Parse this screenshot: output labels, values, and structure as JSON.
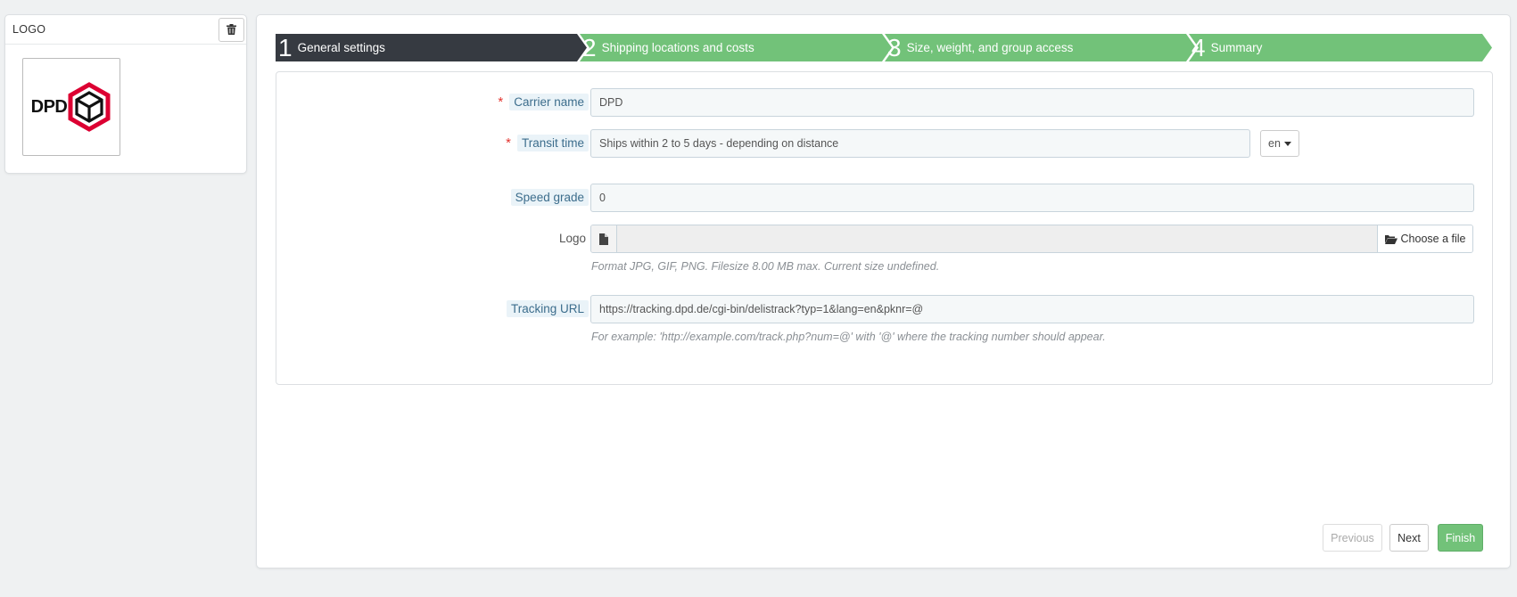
{
  "logo_panel": {
    "title": "LOGO",
    "logo_text": "DPD"
  },
  "steps": [
    {
      "number": "1",
      "label": "General settings"
    },
    {
      "number": "2",
      "label": "Shipping locations and costs"
    },
    {
      "number": "3",
      "label": "Size, weight, and group access"
    },
    {
      "number": "4",
      "label": "Summary"
    }
  ],
  "form": {
    "carrier_name": {
      "label": "Carrier name",
      "required_mark": "*",
      "value": "DPD"
    },
    "transit_time": {
      "label": "Transit time",
      "required_mark": "*",
      "value": "Ships within 2 to 5 days - depending on distance",
      "lang": "en"
    },
    "speed_grade": {
      "label": "Speed grade",
      "value": "0"
    },
    "logo": {
      "label": "Logo",
      "button": "Choose a file",
      "help": "Format JPG, GIF, PNG. Filesize 8.00 MB max. Current size undefined."
    },
    "tracking_url": {
      "label": "Tracking URL",
      "value": "https://tracking.dpd.de/cgi-bin/delistrack?typ=1&lang=en&pknr=@",
      "help": "For example: 'http://example.com/track.php?num=@' with '@' where the tracking number should appear."
    }
  },
  "footer": {
    "previous": "Previous",
    "next": "Next",
    "finish": "Finish"
  },
  "colors": {
    "step_active": "#363a41",
    "step_todo": "#72c279",
    "required": "#e3342f",
    "label_hint_bg": "#eaf3f8"
  }
}
